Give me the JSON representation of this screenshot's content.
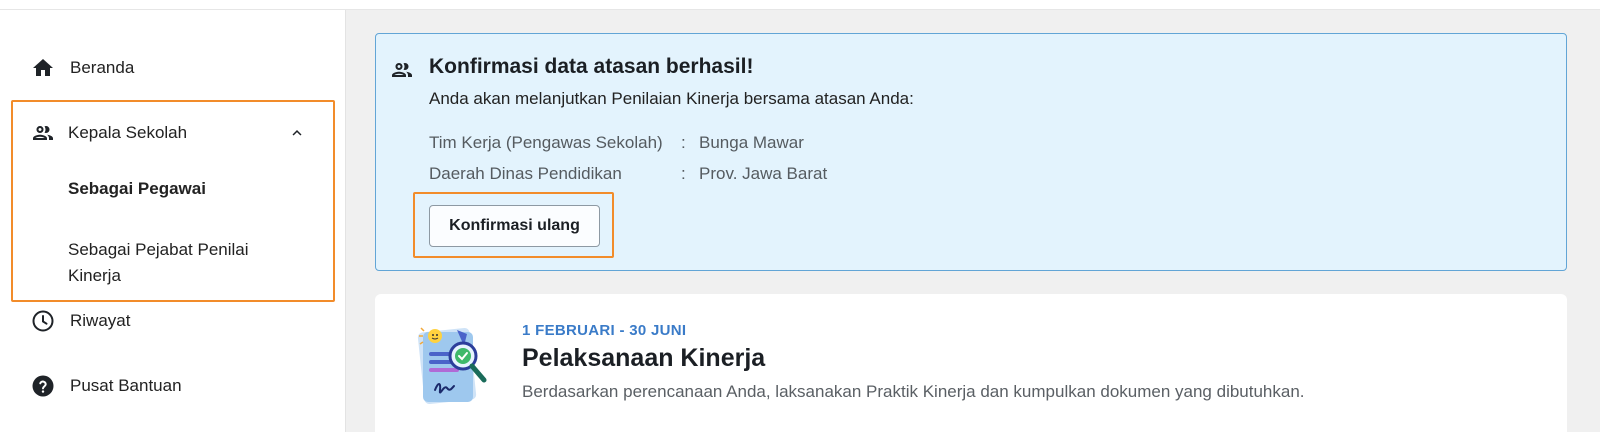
{
  "sidebar": {
    "items": [
      {
        "label": "Beranda",
        "icon": "home-icon"
      },
      {
        "label": "Kepala Sekolah",
        "icon": "people-icon"
      },
      {
        "label": "Riwayat",
        "icon": "clock-icon"
      },
      {
        "label": "Pusat Bantuan",
        "icon": "help-icon"
      }
    ],
    "sub_items": [
      {
        "label": "Sebagai Pegawai"
      },
      {
        "label_line1": "Sebagai Pejabat Penilai",
        "label_line2": "Kinerja"
      }
    ]
  },
  "alert": {
    "title": "Konfirmasi data atasan berhasil!",
    "description": "Anda akan melanjutkan Penilaian Kinerja bersama atasan Anda:",
    "rows": [
      {
        "key": "Tim Kerja (Pengawas Sekolah)",
        "sep": ":",
        "value": "Bunga Mawar"
      },
      {
        "key": "Daerah Dinas Pendidikan",
        "sep": ":",
        "value": "Prov. Jawa Barat"
      }
    ],
    "button_label": "Konfirmasi ulang"
  },
  "card": {
    "date": "1 FEBRUARI - 30 JUNI",
    "title": "Pelaksanaan Kinerja",
    "description": "Berdasarkan perencanaan Anda, laksanakan Praktik Kinerja dan kumpulkan dokumen yang dibutuhkan."
  },
  "colors": {
    "highlight": "#f28c2a",
    "alert_bg": "#e3f3fd",
    "alert_border": "#62a5d6",
    "date_blue": "#3a7bc8"
  }
}
